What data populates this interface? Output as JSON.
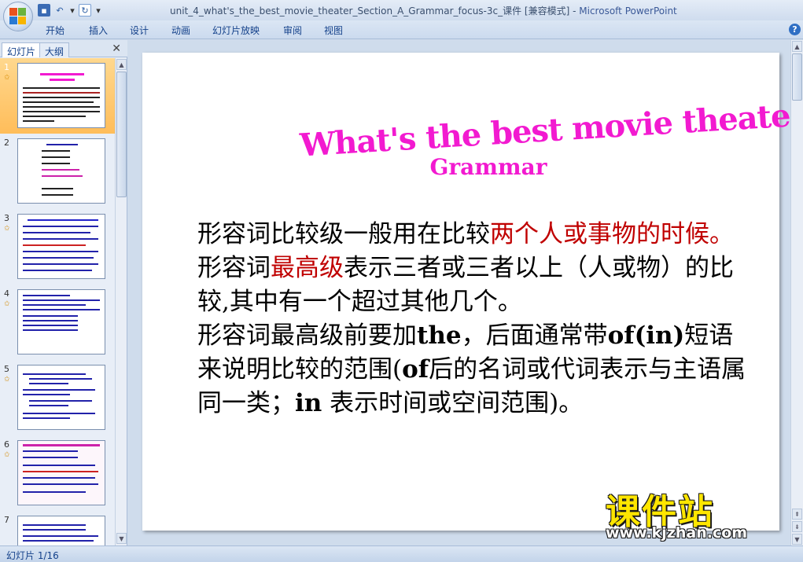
{
  "window": {
    "title": "unit_4_what's_the_best_movie_theater_Section_A_Grammar_focus-3c_课件 [兼容模式]",
    "separator": " - ",
    "app_name": "Microsoft PowerPoint"
  },
  "quick_access": {
    "icons": [
      "save-icon",
      "undo-icon",
      "dropdown-icon",
      "redo-icon",
      "customize-icon"
    ]
  },
  "ribbon": {
    "tabs": [
      "开始",
      "插入",
      "设计",
      "动画",
      "幻灯片放映",
      "审阅",
      "视图"
    ],
    "help": "?"
  },
  "left_pane": {
    "tab_slides": "幻灯片",
    "tab_outline": "大纲",
    "close": "✕",
    "thumbnails": [
      {
        "number": "1",
        "selected": true,
        "has_animation": true
      },
      {
        "number": "2",
        "selected": false,
        "has_animation": false
      },
      {
        "number": "3",
        "selected": false,
        "has_animation": true
      },
      {
        "number": "4",
        "selected": false,
        "has_animation": true
      },
      {
        "number": "5",
        "selected": false,
        "has_animation": true
      },
      {
        "number": "6",
        "selected": false,
        "has_animation": true
      },
      {
        "number": "7",
        "selected": false,
        "has_animation": false
      }
    ]
  },
  "slide": {
    "title_line1": "What's the best movie theater",
    "title_line2": "Grammar",
    "p1_a": "形容词比较级一般用在比较",
    "p1_red": "两个人或事物的时候。",
    "p1_b": "形容词",
    "p1_red2": "最高级",
    "p1_c": "表示三者或三者以上（人或物）的比较,其中有一个超过其他几个。",
    "p2_a": "形容词最高级前要加",
    "p2_the": "the",
    "p2_b": "，后面通常带",
    "p2_of": "of",
    "p2_c": "(in)",
    "p2_d": "短语来说明比较的范围(",
    "p2_of2": "of",
    "p2_e": "后的名词或代词表示与主语属同一类；",
    "p2_in": "in",
    "p2_f": " 表示时间或空间范围)。"
  },
  "watermark": {
    "cn": "课件站",
    "url": "www.kjzhan.com"
  },
  "status": {
    "slide_info": "幻灯片 1/16"
  },
  "colors": {
    "title_magenta": "#f21ad0",
    "emphasis_red": "#c00000",
    "selected_thumb": "#ffbd5a",
    "chrome_blue": "#cfdcec"
  }
}
